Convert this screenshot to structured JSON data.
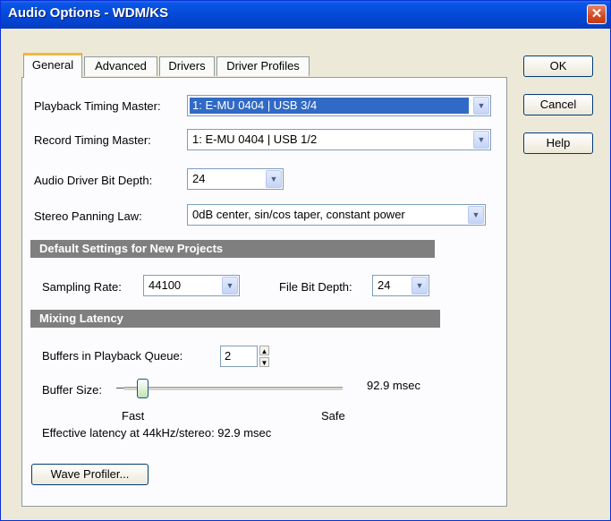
{
  "window": {
    "title": "Audio Options - WDM/KS",
    "close_glyph": "✕"
  },
  "tabs": [
    {
      "label": "General",
      "active": true
    },
    {
      "label": "Advanced",
      "active": false
    },
    {
      "label": "Drivers",
      "active": false
    },
    {
      "label": "Driver Profiles",
      "active": false
    }
  ],
  "buttons": {
    "ok": "OK",
    "cancel": "Cancel",
    "help": "Help",
    "wave_profiler": "Wave Profiler..."
  },
  "general": {
    "playback_master": {
      "label": "Playback Timing Master:",
      "value": "1: E-MU 0404 | USB 3/4"
    },
    "record_master": {
      "label": "Record Timing Master:",
      "value": "1: E-MU 0404 | USB 1/2"
    },
    "bit_depth": {
      "label": "Audio Driver Bit Depth:",
      "value": "24"
    },
    "panning": {
      "label": "Stereo Panning Law:",
      "value": "0dB center, sin/cos taper, constant power"
    }
  },
  "defaults": {
    "header": "Default Settings for New Projects",
    "sampling_rate": {
      "label": "Sampling Rate:",
      "value": "44100"
    },
    "file_bit_depth": {
      "label": "File Bit Depth:",
      "value": "24"
    }
  },
  "latency": {
    "header": "Mixing Latency",
    "buffers": {
      "label": "Buffers in Playback Queue:",
      "value": "2"
    },
    "buffer_size": {
      "label": "Buffer Size:",
      "value_text": "92.9 msec",
      "min_label": "Fast",
      "max_label": "Safe",
      "slider_fraction": 0.06
    },
    "effective": "Effective latency at 44kHz/stereo:  92.9 msec"
  },
  "colors": {
    "titlebar": "#0449d8",
    "selection": "#316ac5",
    "section_header": "#7f7f7f",
    "close": "#d04a23",
    "active_tab": "#f5b83a"
  },
  "icons": {
    "dropdown": "▼",
    "spin_up": "▲",
    "spin_down": "▼"
  }
}
